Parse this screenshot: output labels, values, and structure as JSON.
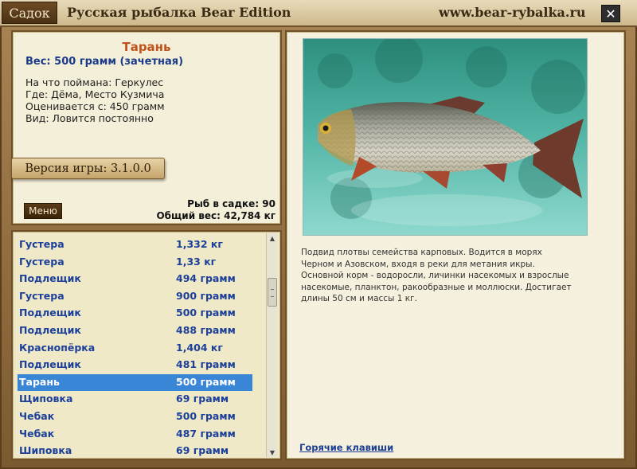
{
  "window": {
    "tab_label": "Садок",
    "title": "Русская рыбалка Bear Edition",
    "site": "www.bear-rybalka.ru",
    "close_symbol": "✕"
  },
  "fish": {
    "name": "Тарань",
    "weight": "Вес: 500 грамм (зачетная)",
    "details": [
      "На что поймана: Геркулес",
      "Где: Дёма, Место Кузмича",
      "Оценивается с: 450 грамм",
      "Вид: Ловится постоянно"
    ]
  },
  "version_label": "Версия игры: 3.1.0.0",
  "menu_label": "Меню",
  "stats": {
    "count_line": "Рыб в садке: 90",
    "total_line": "Общий вес: 42,784 кг"
  },
  "list": {
    "rows": [
      {
        "name": "Густера",
        "weight": "1,332 кг"
      },
      {
        "name": "Густера",
        "weight": "1,33 кг"
      },
      {
        "name": "Подлещик",
        "weight": "494 грамм"
      },
      {
        "name": "Густера",
        "weight": "900 грамм"
      },
      {
        "name": "Подлещик",
        "weight": "500 грамм"
      },
      {
        "name": "Подлещик",
        "weight": "488 грамм"
      },
      {
        "name": "Краснопёрка",
        "weight": "1,404 кг"
      },
      {
        "name": "Подлещик",
        "weight": "481 грамм"
      },
      {
        "name": "Тарань",
        "weight": "500 грамм"
      },
      {
        "name": "Щиповка",
        "weight": "69 грамм"
      },
      {
        "name": "Чебак",
        "weight": "500 грамм"
      },
      {
        "name": "Чебак",
        "weight": "487 грамм"
      },
      {
        "name": "Шиповка",
        "weight": "69 грамм"
      }
    ],
    "selected_index": 8
  },
  "description": "Подвид плотвы семейства карповых. Водится в морях Черном и Азовском, входя в реки для метания икры. Основной корм - водоросли, личинки насекомых и взрослые насекомые, планктон, ракообразные и моллюски. Достигает длины 50 см и массы 1 кг.",
  "hotkeys_label": "Горячие клавиши",
  "icons": {
    "scroll_up": "scroll-up-arrow-icon",
    "scroll_down": "scroll-down-arrow-icon",
    "close": "close-icon"
  },
  "colors": {
    "accent_title": "#c0521b",
    "list_text": "#1c3f9a",
    "selected_row": "#3a86d6",
    "frame": "#8a6a3c"
  }
}
